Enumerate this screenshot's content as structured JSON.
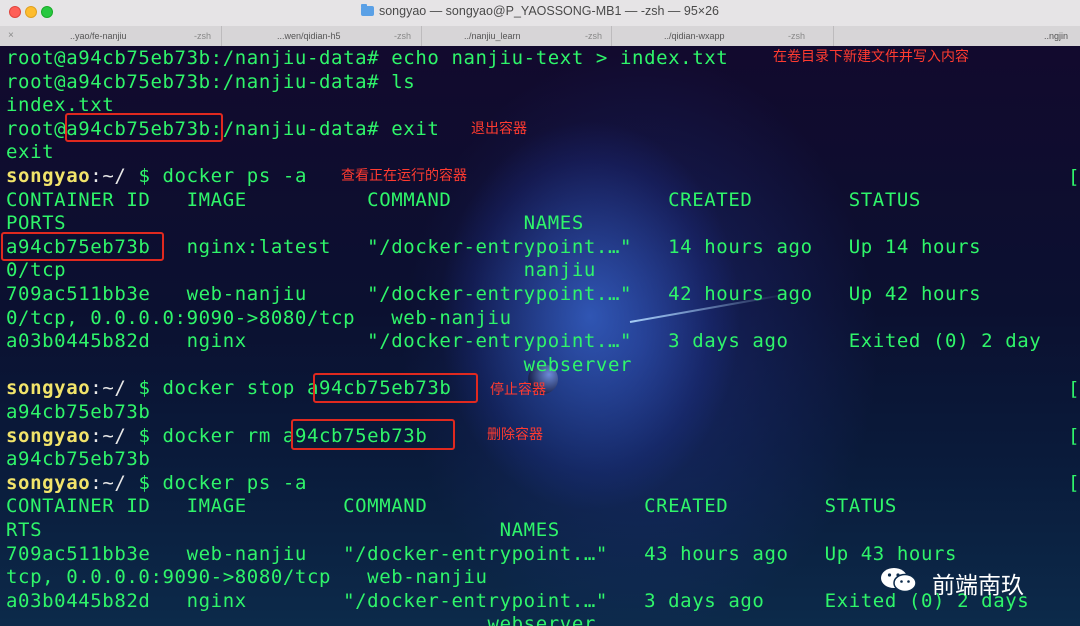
{
  "window": {
    "title": "songyao — songyao@P_YAOSSONG-MB1 — -zsh — 95×26"
  },
  "tabs": [
    {
      "name": "..yao/fe-nanjiu",
      "shell": "-zsh"
    },
    {
      "name": "...wen/qidian-h5",
      "shell": "-zsh"
    },
    {
      "name": "../nanjiu_learn",
      "shell": "-zsh"
    },
    {
      "name": "../qidian-wxapp",
      "shell": "-zsh"
    },
    {
      "name": "..ngjin",
      "shell": ""
    }
  ],
  "terminal": {
    "lines": [
      {
        "segments": [
          {
            "t": "root@a94cb75eb73b:/nanjiu-data# echo nanjiu-text > index.txt",
            "c": "g"
          }
        ]
      },
      {
        "segments": [
          {
            "t": "root@a94cb75eb73b:/nanjiu-data# ls",
            "c": "g"
          }
        ]
      },
      {
        "segments": [
          {
            "t": "index.txt",
            "c": "g"
          }
        ]
      },
      {
        "segments": [
          {
            "t": "root@a94cb75eb73b:/nanjiu-data# exit",
            "c": "g"
          }
        ]
      },
      {
        "segments": [
          {
            "t": "exit",
            "c": "g"
          }
        ]
      },
      {
        "segments": [
          {
            "t": "songyao",
            "c": "p"
          },
          {
            "t": ":~/ ",
            "c": "w"
          },
          {
            "t": "$ docker ps -a",
            "c": "g"
          }
        ]
      },
      {
        "segments": [
          {
            "t": "CONTAINER ID   IMAGE          COMMAND                  CREATED        STATUS",
            "c": "g"
          }
        ]
      },
      {
        "segments": [
          {
            "t": "PORTS                                      NAMES",
            "c": "g"
          }
        ]
      },
      {
        "segments": [
          {
            "t": "a94cb75eb73b   nginx:latest   \"/docker-entrypoint.…\"   14 hours ago   Up 14 hours",
            "c": "g"
          }
        ]
      },
      {
        "segments": [
          {
            "t": "0/tcp                                      nanjiu",
            "c": "g"
          }
        ]
      },
      {
        "segments": [
          {
            "t": "709ac511bb3e   web-nanjiu     \"/docker-entrypoint.…\"   42 hours ago   Up 42 hours",
            "c": "g"
          }
        ]
      },
      {
        "segments": [
          {
            "t": "0/tcp, 0.0.0.0:9090->8080/tcp   web-nanjiu",
            "c": "g"
          }
        ]
      },
      {
        "segments": [
          {
            "t": "a03b0445b82d   nginx          \"/docker-entrypoint.…\"   3 days ago     Exited (0) 2 day",
            "c": "g"
          }
        ]
      },
      {
        "segments": [
          {
            "t": "                                           webserver",
            "c": "g"
          }
        ]
      },
      {
        "segments": [
          {
            "t": "songyao",
            "c": "p"
          },
          {
            "t": ":~/ ",
            "c": "w"
          },
          {
            "t": "$ docker stop a94cb75eb73b",
            "c": "g"
          }
        ]
      },
      {
        "segments": [
          {
            "t": "a94cb75eb73b",
            "c": "g"
          }
        ]
      },
      {
        "segments": [
          {
            "t": "songyao",
            "c": "p"
          },
          {
            "t": ":~/ ",
            "c": "w"
          },
          {
            "t": "$ docker rm a94cb75eb73b",
            "c": "g"
          }
        ]
      },
      {
        "segments": [
          {
            "t": "a94cb75eb73b",
            "c": "g"
          }
        ]
      },
      {
        "segments": [
          {
            "t": "songyao",
            "c": "p"
          },
          {
            "t": ":~/ ",
            "c": "w"
          },
          {
            "t": "$ docker ps -a",
            "c": "g"
          }
        ]
      },
      {
        "segments": [
          {
            "t": "CONTAINER ID   IMAGE        COMMAND                  CREATED        STATUS",
            "c": "g"
          }
        ]
      },
      {
        "segments": [
          {
            "t": "RTS                                      NAMES",
            "c": "g"
          }
        ]
      },
      {
        "segments": [
          {
            "t": "709ac511bb3e   web-nanjiu   \"/docker-entrypoint.…\"   43 hours ago   Up 43 hours",
            "c": "g"
          }
        ]
      },
      {
        "segments": [
          {
            "t": "tcp, 0.0.0.0:9090->8080/tcp   web-nanjiu",
            "c": "g"
          }
        ]
      },
      {
        "segments": [
          {
            "t": "a03b0445b82d   nginx        \"/docker-entrypoint.…\"   3 days ago     Exited (0) 2 days",
            "c": "g"
          }
        ]
      },
      {
        "segments": [
          {
            "t": "                                        webserver",
            "c": "g"
          }
        ]
      }
    ],
    "right_edge_marker": "[",
    "annotations": {
      "write_file": "在卷目录下新建文件并写入内容",
      "exit_container": "退出容器",
      "view_running": "查看正在运行的容器",
      "stop_container": "停止容器",
      "remove_container": "删除容器"
    }
  },
  "watermark": {
    "text": "前端南玖",
    "icon": "wechat-icon"
  },
  "colors": {
    "prompt_user": "#f2e46a",
    "terminal_text": "#2ff56a",
    "annotation": "#ff3b30"
  }
}
